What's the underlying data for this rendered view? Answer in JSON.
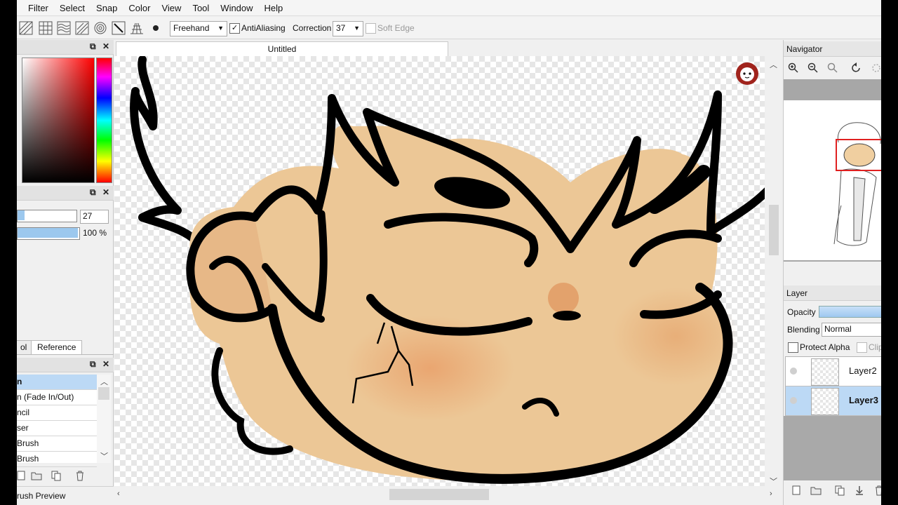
{
  "menu": [
    "Filter",
    "Select",
    "Snap",
    "Color",
    "View",
    "Tool",
    "Window",
    "Help"
  ],
  "toolbar": {
    "mode_select": "Freehand",
    "antialias_label": "AntiAliasing",
    "antialias_check": "✓",
    "correction_label": "Correction",
    "correction_value": "37",
    "soft_edge_label": "Soft Edge"
  },
  "left_panel": {
    "size_value": "27",
    "size_fraction": 0.12,
    "density_label": "100 %",
    "density_fraction": 1.0,
    "tabs": [
      "ol",
      "Reference"
    ],
    "brushes": [
      "n",
      "n (Fade In/Out)",
      "ncil",
      "ser",
      "Brush",
      "Brush"
    ],
    "status": "rush Preview",
    "float_icon": "⧉",
    "close_icon": "✕"
  },
  "canvas": {
    "doc_title": "Untitled"
  },
  "navigator": {
    "title": "Navigator"
  },
  "layer_panel": {
    "title": "Layer",
    "opacity_label": "Opacity",
    "blending_label": "Blending",
    "blending_value": "Normal",
    "protect_alpha_label": "Protect Alpha",
    "clip_label": "Clip",
    "layers": [
      {
        "name": "Layer2",
        "selected": false
      },
      {
        "name": "Layer3",
        "selected": true
      }
    ]
  },
  "colors": {
    "selection_blue": "#bcd9f5",
    "skin": "#ecc796",
    "outline": "#000000"
  }
}
